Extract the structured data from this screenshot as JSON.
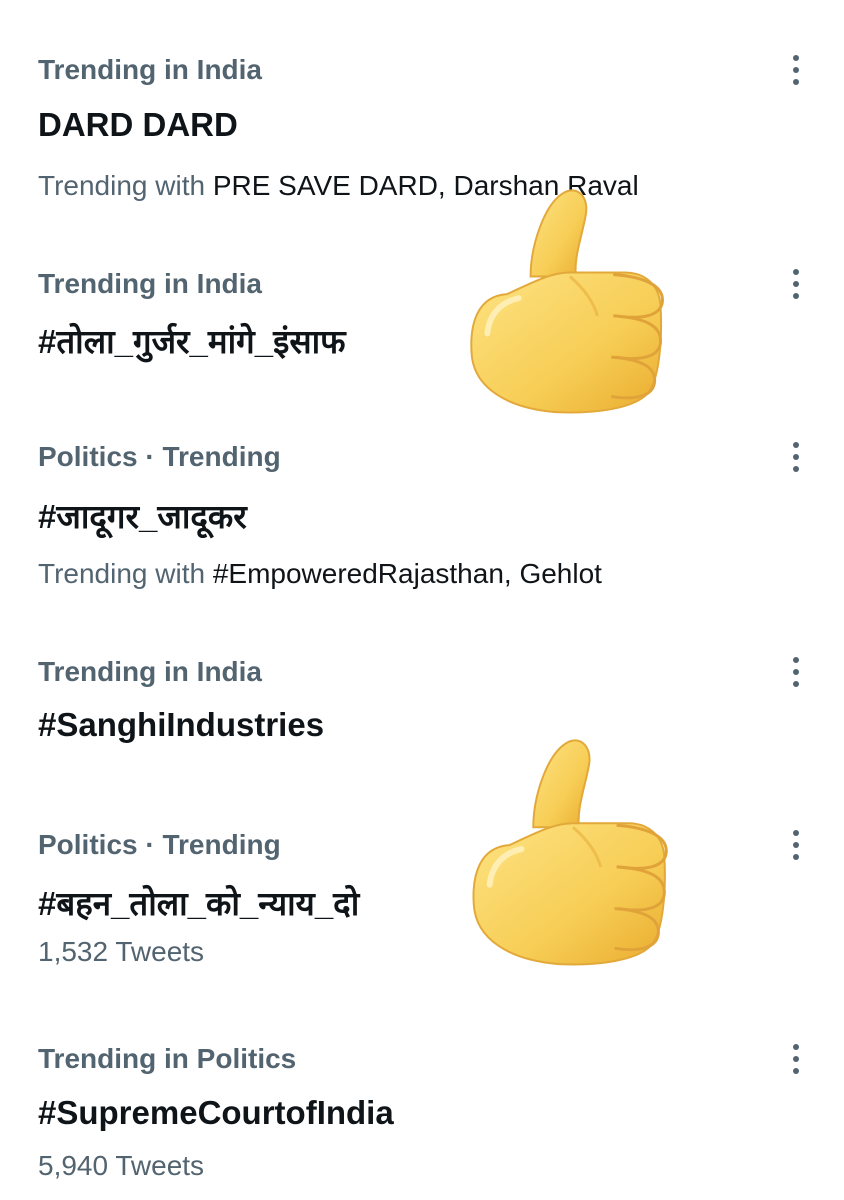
{
  "trends": [
    {
      "context": "Trending in India",
      "name": "DARD DARD",
      "meta_prefix": "Trending with ",
      "meta_items": "PRE SAVE DARD, Darshan Raval",
      "more_icon": "more-vertical-icon"
    },
    {
      "context": "Trending in India",
      "name": "#तोला_गुर्जर_मांगे_इंसाफ",
      "more_icon": "more-vertical-icon"
    },
    {
      "context": "Politics · Trending",
      "name": "#जादूगर_जादूकर",
      "meta_prefix": "Trending with ",
      "meta_items": "#EmpoweredRajasthan, Gehlot",
      "more_icon": "more-vertical-icon"
    },
    {
      "context": "Trending in India",
      "name": "#SanghiIndustries",
      "more_icon": "more-vertical-icon"
    },
    {
      "context": "Politics · Trending",
      "name": "#बहन_तोला_को_न्याय_दो",
      "meta_count": "1,532 Tweets",
      "more_icon": "more-vertical-icon"
    },
    {
      "context": "Trending in Politics",
      "name": "#SupremeCourtofIndia",
      "meta_count": "5,940 Tweets",
      "more_icon": "more-vertical-icon"
    }
  ],
  "stickers": [
    {
      "icon": "thumbs-up-icon"
    },
    {
      "icon": "thumbs-up-icon"
    }
  ],
  "colors": {
    "primary_text": "#0f1419",
    "secondary_text": "#536471",
    "emoji_yellow": "#f5c84a"
  }
}
